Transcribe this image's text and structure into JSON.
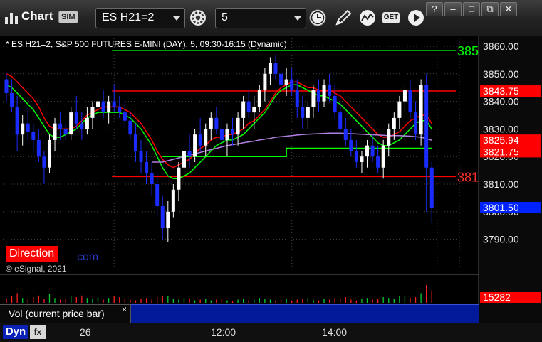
{
  "toolbar": {
    "app_title": "Chart",
    "sim_badge": "SIM",
    "symbol": "ES H21=2",
    "interval": "5",
    "get_label": "GET",
    "help_label": "?",
    "minimize_label": "–",
    "maximize_label": "□",
    "restore_label": "⧉",
    "close_label": "✕",
    "icons": [
      "app-chart-icon",
      "sim-icon",
      "gear-icon",
      "clock-icon",
      "pencil-icon",
      "study-wave-icon",
      "get-icon",
      "play-icon"
    ]
  },
  "chart": {
    "heading": "* ES H21=2, S&P 500 FUTURES E-MINI (DAY), 5, 09:30-16:15 (Dynamic)",
    "direction_label": "Direction",
    "watermark_domain": "com",
    "copyright": "© eSignal, 2021",
    "line_labels": [
      {
        "text": "385",
        "color": "#00ff00",
        "value": 3858.5
      },
      {
        "text": "381",
        "color": "#ff3030",
        "value": 3812.75
      }
    ],
    "price_tags": [
      {
        "text": "3843.75",
        "value": 3843.75,
        "bg": "#ff0000",
        "fg": "#ffffff"
      },
      {
        "text": "3825.94",
        "value": 3825.94,
        "bg": "#ff0000",
        "fg": "#ffffff"
      },
      {
        "text": "3821.75",
        "value": 3821.75,
        "bg": "#ff0000",
        "fg": "#ffffff"
      },
      {
        "text": "3801.50",
        "value": 3801.5,
        "bg": "#0022ff",
        "fg": "#ffffff"
      }
    ],
    "colors": {
      "up": "#ffffff",
      "down": "#1a2cff",
      "green": "#00ff00",
      "red": "#ff0000",
      "avg": "#b080e0",
      "grid": "#444444"
    }
  },
  "chart_data": [
    {
      "type": "candlestick",
      "title": "* ES H21=2, S&P 500 FUTURES E-MINI (DAY), 5, 09:30-16:15 (Dynamic)",
      "ylim": [
        3785,
        3865
      ],
      "yticks": [
        3790,
        3800,
        3810,
        3820,
        3830,
        3840,
        3850,
        3860
      ],
      "ytick_labels": [
        "3790.00",
        "3800.00",
        "3810.00",
        "3820.00",
        "3830.00",
        "3840.00",
        "3850.00",
        "3860.00"
      ],
      "x_labels": [
        {
          "index": 20,
          "text": "26"
        },
        {
          "index": 53,
          "text": "12:00"
        },
        {
          "index": 80,
          "text": "14:00"
        }
      ],
      "candles": [
        [
          3848,
          3850,
          3840,
          3843
        ],
        [
          3843,
          3848,
          3836,
          3838
        ],
        [
          3838,
          3842,
          3822,
          3828
        ],
        [
          3828,
          3835,
          3824,
          3832
        ],
        [
          3832,
          3838,
          3826,
          3829
        ],
        [
          3829,
          3832,
          3822,
          3826
        ],
        [
          3826,
          3830,
          3818,
          3820
        ],
        [
          3820,
          3822,
          3810,
          3816
        ],
        [
          3816,
          3828,
          3814,
          3826
        ],
        [
          3826,
          3834,
          3822,
          3832
        ],
        [
          3832,
          3836,
          3826,
          3830
        ],
        [
          3830,
          3832,
          3826,
          3828
        ],
        [
          3828,
          3838,
          3826,
          3836
        ],
        [
          3836,
          3842,
          3830,
          3832
        ],
        [
          3832,
          3836,
          3826,
          3830
        ],
        [
          3830,
          3838,
          3828,
          3834
        ],
        [
          3834,
          3840,
          3830,
          3838
        ],
        [
          3838,
          3842,
          3834,
          3840
        ],
        [
          3840,
          3844,
          3834,
          3836
        ],
        [
          3836,
          3842,
          3832,
          3840
        ],
        [
          3840,
          3846,
          3836,
          3838
        ],
        [
          3838,
          3842,
          3834,
          3836
        ],
        [
          3836,
          3840,
          3830,
          3833
        ],
        [
          3833,
          3836,
          3826,
          3828
        ],
        [
          3828,
          3832,
          3818,
          3822
        ],
        [
          3822,
          3826,
          3814,
          3818
        ],
        [
          3818,
          3822,
          3810,
          3814
        ],
        [
          3814,
          3818,
          3806,
          3810
        ],
        [
          3810,
          3814,
          3798,
          3802
        ],
        [
          3802,
          3806,
          3790,
          3794
        ],
        [
          3794,
          3804,
          3789,
          3800
        ],
        [
          3800,
          3810,
          3798,
          3808
        ],
        [
          3808,
          3818,
          3804,
          3816
        ],
        [
          3816,
          3824,
          3812,
          3822
        ],
        [
          3822,
          3828,
          3816,
          3820
        ],
        [
          3820,
          3830,
          3818,
          3828
        ],
        [
          3828,
          3834,
          3822,
          3824
        ],
        [
          3824,
          3832,
          3820,
          3830
        ],
        [
          3830,
          3836,
          3826,
          3834
        ],
        [
          3834,
          3838,
          3828,
          3830
        ],
        [
          3830,
          3834,
          3822,
          3826
        ],
        [
          3826,
          3832,
          3820,
          3830
        ],
        [
          3830,
          3834,
          3824,
          3828
        ],
        [
          3828,
          3836,
          3824,
          3834
        ],
        [
          3834,
          3842,
          3830,
          3840
        ],
        [
          3840,
          3844,
          3834,
          3836
        ],
        [
          3836,
          3842,
          3830,
          3838
        ],
        [
          3838,
          3846,
          3836,
          3844
        ],
        [
          3844,
          3852,
          3840,
          3850
        ],
        [
          3850,
          3856,
          3846,
          3854
        ],
        [
          3854,
          3857,
          3848,
          3850
        ],
        [
          3850,
          3854,
          3844,
          3846
        ],
        [
          3846,
          3852,
          3842,
          3848
        ],
        [
          3848,
          3852,
          3842,
          3844
        ],
        [
          3844,
          3848,
          3834,
          3838
        ],
        [
          3838,
          3842,
          3830,
          3834
        ],
        [
          3834,
          3840,
          3830,
          3838
        ],
        [
          3838,
          3846,
          3834,
          3844
        ],
        [
          3844,
          3848,
          3836,
          3840
        ],
        [
          3840,
          3848,
          3838,
          3846
        ],
        [
          3846,
          3850,
          3840,
          3842
        ],
        [
          3842,
          3846,
          3834,
          3836
        ],
        [
          3836,
          3840,
          3828,
          3830
        ],
        [
          3830,
          3834,
          3824,
          3826
        ],
        [
          3826,
          3830,
          3820,
          3822
        ],
        [
          3822,
          3826,
          3816,
          3818
        ],
        [
          3818,
          3822,
          3814,
          3820
        ],
        [
          3820,
          3826,
          3816,
          3824
        ],
        [
          3824,
          3828,
          3818,
          3820
        ],
        [
          3820,
          3824,
          3814,
          3816
        ],
        [
          3816,
          3826,
          3812,
          3824
        ],
        [
          3824,
          3832,
          3820,
          3830
        ],
        [
          3830,
          3836,
          3826,
          3834
        ],
        [
          3834,
          3842,
          3830,
          3840
        ],
        [
          3840,
          3846,
          3836,
          3844
        ],
        [
          3844,
          3848,
          3834,
          3836
        ],
        [
          3836,
          3840,
          3826,
          3828
        ],
        [
          3828,
          3848,
          3824,
          3846
        ],
        [
          3846,
          3850,
          3800,
          3816
        ],
        [
          3816,
          3818,
          3796,
          3801.5
        ]
      ]
    },
    {
      "type": "line",
      "series": [
        {
          "name": "",
          "color": "#ff0000",
          "values": [
            3850,
            3849,
            3847,
            3845,
            3843,
            3841,
            3838,
            3834,
            3831,
            3830,
            3830,
            3830,
            3830,
            3831,
            3833,
            3835,
            3836,
            3837,
            3838,
            3838,
            3838,
            3838,
            3837,
            3836,
            3834,
            3832,
            3829,
            3826,
            3822,
            3819,
            3817,
            3816,
            3817,
            3818,
            3819,
            3821,
            3823,
            3824,
            3826,
            3827,
            3827,
            3828,
            3828,
            3829,
            3830,
            3832,
            3833,
            3835,
            3837,
            3840,
            3843,
            3845,
            3846,
            3847,
            3847,
            3846,
            3845,
            3845,
            3844,
            3844,
            3844,
            3843,
            3842,
            3840,
            3838,
            3836,
            3834,
            3832,
            3830,
            3828,
            3827,
            3827,
            3828,
            3829,
            3831,
            3833,
            3834,
            3835,
            3835,
            3832
          ]
        },
        {
          "name": "",
          "color": "#00ff00",
          "values": [
            3846,
            3845,
            3843,
            3841,
            3839,
            3837,
            3834,
            3831,
            3828,
            3827,
            3827,
            3828,
            3829,
            3830,
            3832,
            3834,
            3835,
            3836,
            3836,
            3836,
            3836,
            3836,
            3835,
            3834,
            3832,
            3830,
            3827,
            3824,
            3820,
            3816,
            3813,
            3812,
            3812,
            3813,
            3814,
            3816,
            3818,
            3820,
            3822,
            3824,
            3825,
            3826,
            3826,
            3827,
            3828,
            3830,
            3832,
            3834,
            3836,
            3839,
            3842,
            3844,
            3845,
            3846,
            3846,
            3845,
            3844,
            3843,
            3842,
            3842,
            3841,
            3840,
            3839,
            3837,
            3835,
            3833,
            3831,
            3829,
            3827,
            3825,
            3824,
            3824,
            3825,
            3826,
            3828,
            3830,
            3832,
            3833,
            3833,
            3830
          ]
        },
        {
          "name": "",
          "color": "#b080e0",
          "values": [
            null,
            null,
            null,
            null,
            null,
            null,
            null,
            null,
            null,
            null,
            null,
            null,
            null,
            null,
            null,
            null,
            null,
            null,
            null,
            null,
            null,
            null,
            null,
            null,
            null,
            null,
            null,
            3818,
            3818,
            3818,
            3818.5,
            3819,
            3819.5,
            3820,
            3820.5,
            3821,
            3821.5,
            3822,
            3822.5,
            3823,
            3823.5,
            3824,
            3824.3,
            3824.6,
            3825,
            3825.3,
            3825.6,
            3826,
            3826.3,
            3826.6,
            3827,
            3827.2,
            3827.4,
            3827.6,
            3827.8,
            3828,
            3828.1,
            3828.2,
            3828.3,
            3828.4,
            3828.5,
            3828.5,
            3828.5,
            3828.4,
            3828.3,
            3828.2,
            3828.1,
            3828,
            3827.9,
            3827.8,
            3827.7,
            3827.6,
            3827.6,
            3827.6,
            3827.5,
            3827.4,
            3827.2,
            3827,
            3826.5,
            3825.94
          ]
        }
      ],
      "hlines": [
        {
          "value": 3858.5,
          "from_index": 20,
          "color": "#00ff00"
        },
        {
          "value": 3843.75,
          "from_index": 20,
          "color": "#ff0000"
        },
        {
          "value": 3812.75,
          "from_index": 20,
          "color": "#ff0000"
        }
      ],
      "step_lines": [
        {
          "color": "#00ff00",
          "points": [
            [
              29,
              3820
            ],
            [
              52,
              3820
            ],
            [
              52,
              3823
            ],
            [
              79,
              3823
            ]
          ]
        }
      ]
    },
    {
      "type": "bar",
      "title": "Vol (current price bar)",
      "last_value_label": "15282",
      "last_value": 15282,
      "ylim": [
        0,
        30000
      ],
      "values": [
        5000,
        8000,
        12000,
        6000,
        4000,
        7000,
        9000,
        5000,
        11000,
        6000,
        4000,
        5000,
        8000,
        7000,
        9000,
        6000,
        5000,
        7000,
        4000,
        6000,
        8000,
        7000,
        5000,
        4000,
        3000,
        5000,
        6000,
        4000,
        7000,
        9000,
        8000,
        5000,
        4000,
        6000,
        5000,
        3000,
        4000,
        5000,
        3000,
        4000,
        5000,
        3000,
        2000,
        4000,
        5000,
        3000,
        4000,
        6000,
        5000,
        4000,
        3000,
        4000,
        5000,
        3000,
        4000,
        5000,
        6000,
        4000,
        3000,
        5000,
        4000,
        6000,
        5000,
        7000,
        4000,
        3000,
        5000,
        6000,
        4000,
        5000,
        7000,
        6000,
        5000,
        8000,
        9000,
        6000,
        7000,
        12000,
        22000,
        15282
      ],
      "colors": {
        "up": "#00cc33",
        "down": "#ff2020"
      }
    }
  ],
  "volume_panel": {
    "label": "Vol (current price bar)",
    "close_label": "×"
  },
  "footer": {
    "dyn_label": "Dyn",
    "fx_label": "fx"
  }
}
